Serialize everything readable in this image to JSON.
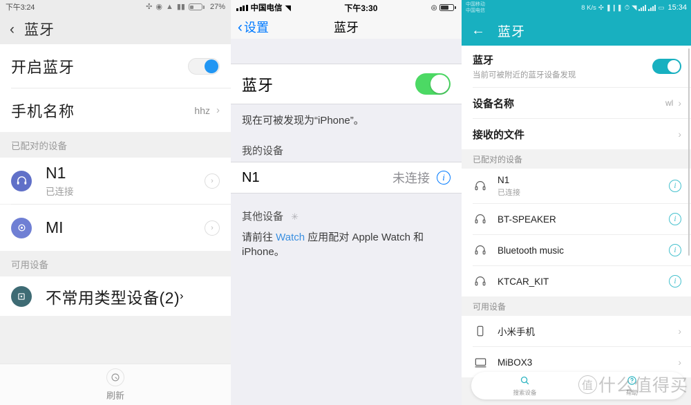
{
  "panel1": {
    "platform": "miui",
    "status": {
      "time": "下午3:24",
      "battery_pct": "27%",
      "icons": [
        "bluetooth-icon",
        "dnd-icon",
        "wifi-icon",
        "signal-icon",
        "battery-icon"
      ]
    },
    "appbar": {
      "back_icon": "chevron-left-icon",
      "title": "蓝牙"
    },
    "rows": [
      {
        "label": "开启蓝牙",
        "type": "toggle",
        "on": true
      },
      {
        "label": "手机名称",
        "type": "value",
        "value": "hhz",
        "chevron": "›"
      }
    ],
    "section_paired": "已配对的设备",
    "paired": [
      {
        "name": "N1",
        "sub": "已连接",
        "icon": "headphone-icon"
      },
      {
        "name": "MI",
        "sub": "",
        "icon": "bluetooth-circle-icon"
      }
    ],
    "section_available": "可用设备",
    "available": [
      {
        "name": "不常用类型设备(2)",
        "icon": "device-square-icon"
      }
    ],
    "refresh": {
      "label": "刷新",
      "icon": "refresh-icon"
    }
  },
  "panel2": {
    "platform": "ios",
    "status": {
      "carrier": "中国电信",
      "time": "下午3:30",
      "wifi_icon": "wifi-icon",
      "lock_icon": "rotation-lock-icon",
      "battery_icon": "battery-icon"
    },
    "nav": {
      "back_label": "设置",
      "back_icon": "chevron-left-icon",
      "title": "蓝牙"
    },
    "bluetooth_row": {
      "label": "蓝牙",
      "on": true
    },
    "discoverable_note": "现在可被发现为“iPhone”。",
    "my_devices_header": "我的设备",
    "my_devices": [
      {
        "name": "N1",
        "status": "未连接",
        "info_icon": "info-icon"
      }
    ],
    "other_devices_header": "其他设备",
    "other_devices_spinner": "spinner-icon",
    "footer_prefix": "请前往 ",
    "footer_link": "Watch",
    "footer_suffix": " 应用配对 Apple Watch 和 iPhone。"
  },
  "panel3": {
    "platform": "emui",
    "status": {
      "carrier_line1": "中国移动",
      "carrier_line2": "中国电信",
      "net_speed": "8 K/s",
      "time": "15:34",
      "icons": [
        "bluetooth-icon",
        "vibrate-icon",
        "alarm-icon",
        "wifi-icon",
        "signal-icon",
        "signal-icon",
        "battery-icon"
      ]
    },
    "appbar": {
      "back_icon": "arrow-left-icon",
      "title": "蓝牙"
    },
    "bluetooth": {
      "title": "蓝牙",
      "subtitle": "当前可被附近的蓝牙设备发现",
      "on": true
    },
    "rows": [
      {
        "label": "设备名称",
        "value": "wl",
        "chevron": "›"
      },
      {
        "label": "接收的文件",
        "value": "",
        "chevron": "›"
      }
    ],
    "section_paired": "已配对的设备",
    "paired": [
      {
        "name": "N1",
        "sub": "已连接",
        "icon": "headphone-icon",
        "action": "info-icon"
      },
      {
        "name": "BT-SPEAKER",
        "sub": "",
        "icon": "headphone-icon",
        "action": "info-icon"
      },
      {
        "name": "Bluetooth music",
        "sub": "",
        "icon": "headphone-icon",
        "action": "info-icon"
      },
      {
        "name": "KTCAR_KIT",
        "sub": "",
        "icon": "headphone-icon",
        "action": "info-icon"
      }
    ],
    "section_available": "可用设备",
    "available": [
      {
        "name": "小米手机",
        "icon": "phone-icon",
        "action": "chevron-right-icon"
      },
      {
        "name": "MiBOX3",
        "icon": "monitor-icon",
        "action": "chevron-right-icon"
      }
    ],
    "bottom_bar": [
      {
        "label": "搜索设备",
        "icon": "search-icon"
      },
      {
        "label": "帮助",
        "icon": "question-icon"
      }
    ],
    "watermark": "什么值得买"
  },
  "colors": {
    "miui_accent": "#2196f3",
    "ios_green": "#4cd964",
    "ios_blue": "#007aff",
    "emui_teal": "#18b0c0"
  }
}
